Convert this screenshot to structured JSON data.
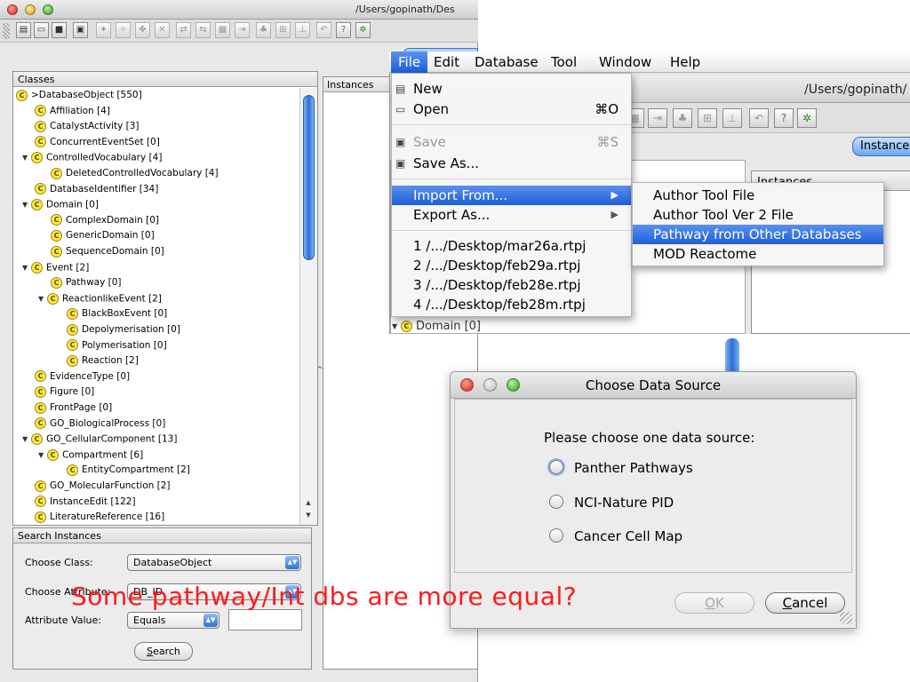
{
  "main_window": {
    "path": "/Users/gopinath/Des",
    "classes_header": "Classes",
    "instances_header": "Instances",
    "class_tree": [
      {
        "label": ">DatabaseObject [550]",
        "depth": 0,
        "expanded": false,
        "root": true
      },
      {
        "label": "Affiliation [4]",
        "depth": 1
      },
      {
        "label": "CatalystActivity [3]",
        "depth": 1
      },
      {
        "label": "ConcurrentEventSet [0]",
        "depth": 1
      },
      {
        "label": "ControlledVocabulary [4]",
        "depth": 1,
        "expanded": true
      },
      {
        "label": "DeletedControlledVocabulary [4]",
        "depth": 2
      },
      {
        "label": "DatabaseIdentifier [34]",
        "depth": 1
      },
      {
        "label": "Domain [0]",
        "depth": 1,
        "expanded": true
      },
      {
        "label": "ComplexDomain [0]",
        "depth": 2
      },
      {
        "label": "GenericDomain [0]",
        "depth": 2
      },
      {
        "label": "SequenceDomain [0]",
        "depth": 2
      },
      {
        "label": "Event [2]",
        "depth": 1,
        "expanded": true
      },
      {
        "label": "Pathway [0]",
        "depth": 2
      },
      {
        "label": "ReactionlikeEvent [2]",
        "depth": 2,
        "expanded": true
      },
      {
        "label": "BlackBoxEvent [0]",
        "depth": 3
      },
      {
        "label": "Depolymerisation [0]",
        "depth": 3
      },
      {
        "label": "Polymerisation [0]",
        "depth": 3
      },
      {
        "label": "Reaction [2]",
        "depth": 3
      },
      {
        "label": "EvidenceType [0]",
        "depth": 1
      },
      {
        "label": "Figure [0]",
        "depth": 1
      },
      {
        "label": "FrontPage [0]",
        "depth": 1
      },
      {
        "label": "GO_BiologicalProcess [0]",
        "depth": 1
      },
      {
        "label": "GO_CellularComponent [13]",
        "depth": 1,
        "expanded": true
      },
      {
        "label": "Compartment [6]",
        "depth": 2,
        "expanded": true
      },
      {
        "label": "EntityCompartment [2]",
        "depth": 3
      },
      {
        "label": "GO_MolecularFunction [2]",
        "depth": 1
      },
      {
        "label": "InstanceEdit [122]",
        "depth": 1
      },
      {
        "label": "LiteratureReference [16]",
        "depth": 1
      }
    ],
    "search": {
      "header": "Search Instances",
      "choose_class_label": "Choose Class:",
      "choose_class_value": "DatabaseObject",
      "choose_attribute_label": "Choose Attribute:",
      "choose_attribute_value": "DB_ID",
      "attribute_value_label": "Attribute Value:",
      "attribute_value_operator": "Equals",
      "button_prefix": "S",
      "button_rest": "earch"
    }
  },
  "second_window": {
    "path": "/Users/gopinath/",
    "tab_label": "Instance",
    "instances_header": "Instances",
    "domain_row": "Domain [0]"
  },
  "menubar": {
    "items": [
      "File",
      "Edit",
      "Database",
      "Tool",
      "Window",
      "Help"
    ],
    "active": "File"
  },
  "file_menu": {
    "new": "New",
    "open": "Open",
    "open_key": "⌘O",
    "save": "Save",
    "save_key": "⌘S",
    "save_as": "Save As...",
    "import_from": "Import From...",
    "export_as": "Export As...",
    "recent": [
      "1 /.../Desktop/mar26a.rtpj",
      "2 /.../Desktop/feb29a.rtpj",
      "3 /.../Desktop/feb28e.rtpj",
      "4 /.../Desktop/feb28m.rtpj"
    ]
  },
  "import_submenu": {
    "items": [
      "Author Tool File",
      "Author Tool Ver 2 File",
      "Pathway from Other Databases",
      "MOD Reactome"
    ],
    "highlighted": 2
  },
  "dialog": {
    "title": "Choose Data Source",
    "prompt": "Please choose one data source:",
    "options": [
      "Panther Pathways",
      "NCI-Nature PID",
      "Cancer Cell Map"
    ],
    "ok_prefix": "O",
    "ok_rest": "K",
    "cancel_prefix": "C",
    "cancel_rest": "ancel"
  },
  "caption": "Some pathway/Int dbs are more equal?",
  "colors": {
    "highlight": "#2a6ae0",
    "caption": "#ff1a1a",
    "class_icon": "#ffe84a"
  }
}
